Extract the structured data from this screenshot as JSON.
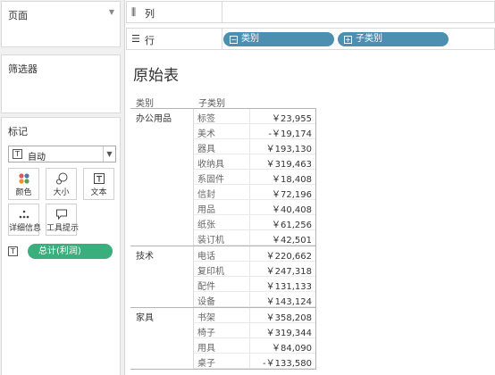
{
  "left_panel": {
    "pages_title": "页面",
    "filters_title": "筛选器",
    "marks": {
      "title": "标记",
      "mark_type": "自动",
      "buttons": {
        "color": "颜色",
        "size": "大小",
        "text": "文本",
        "detail": "详细信息",
        "tooltip": "工具提示"
      },
      "field_pill": "总计(利润)"
    }
  },
  "shelves": {
    "columns_label": "列",
    "rows_label": "行",
    "row_pills": [
      "类别",
      "子类别"
    ]
  },
  "sheet": {
    "title": "原始表",
    "header_category": "类别",
    "header_subcategory": "子类别",
    "groups": [
      {
        "category": "办公用品",
        "rows": [
          {
            "sub": "标签",
            "value": "￥23,955"
          },
          {
            "sub": "美术",
            "value": "-￥19,174"
          },
          {
            "sub": "器具",
            "value": "￥193,130"
          },
          {
            "sub": "收纳具",
            "value": "￥319,463"
          },
          {
            "sub": "系固件",
            "value": "￥18,408"
          },
          {
            "sub": "信封",
            "value": "￥72,196"
          },
          {
            "sub": "用品",
            "value": "￥40,408"
          },
          {
            "sub": "纸张",
            "value": "￥61,256"
          },
          {
            "sub": "装订机",
            "value": "￥42,501"
          }
        ]
      },
      {
        "category": "技术",
        "rows": [
          {
            "sub": "电话",
            "value": "￥220,662"
          },
          {
            "sub": "复印机",
            "value": "￥247,318"
          },
          {
            "sub": "配件",
            "value": "￥131,133"
          },
          {
            "sub": "设备",
            "value": "￥143,124"
          }
        ]
      },
      {
        "category": "家具",
        "rows": [
          {
            "sub": "书架",
            "value": "￥358,208"
          },
          {
            "sub": "椅子",
            "value": "￥319,344"
          },
          {
            "sub": "用具",
            "value": "￥84,090"
          },
          {
            "sub": "桌子",
            "value": "-￥133,580"
          }
        ]
      }
    ]
  },
  "colors": {
    "row_pill": "#4c8fb0",
    "measure_pill": "#3aae7c"
  }
}
